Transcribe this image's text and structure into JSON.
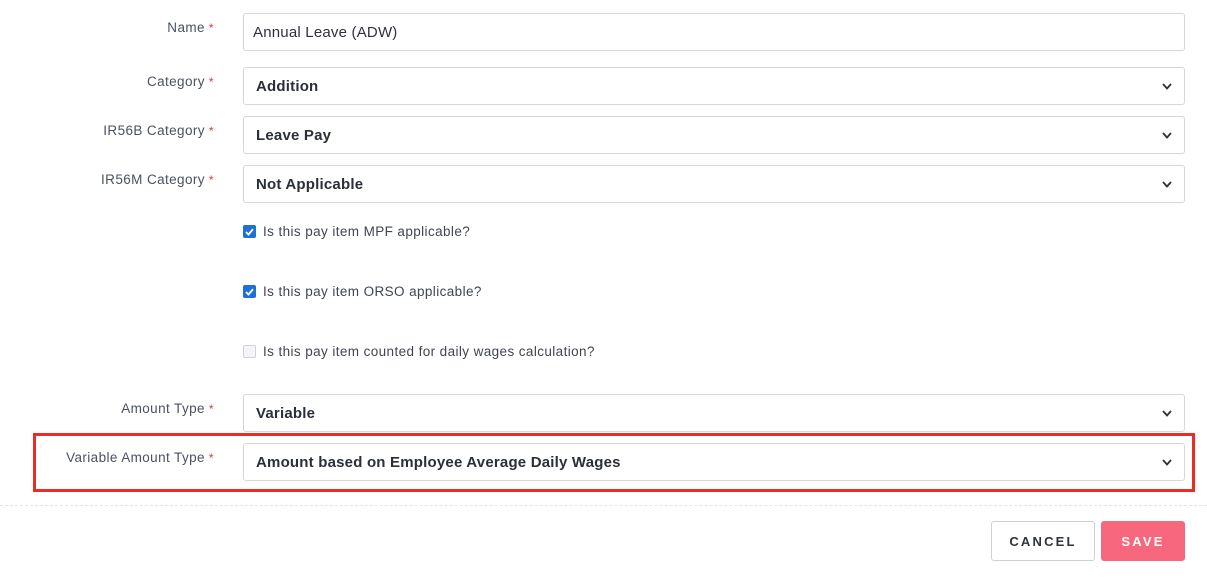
{
  "form": {
    "name": {
      "label": "Name",
      "required_mark": "*",
      "value": "Annual Leave (ADW)"
    },
    "category": {
      "label": "Category",
      "required_mark": "*",
      "value": "Addition"
    },
    "ir56b_category": {
      "label": "IR56B Category",
      "required_mark": "*",
      "value": "Leave Pay"
    },
    "ir56m_category": {
      "label": "IR56M Category",
      "required_mark": "*",
      "value": "Not Applicable"
    },
    "checkboxes": [
      {
        "label": "Is this pay item MPF applicable?",
        "checked": true
      },
      {
        "label": "Is this pay item ORSO applicable?",
        "checked": true
      },
      {
        "label": "Is this pay item counted for daily wages calculation?",
        "checked": false
      }
    ],
    "amount_type": {
      "label": "Amount Type",
      "required_mark": "*",
      "value": "Variable"
    },
    "variable_amount_type": {
      "label": "Variable Amount Type",
      "required_mark": "*",
      "value": "Amount based on Employee Average Daily Wages"
    }
  },
  "actions": {
    "cancel_label": "CANCEL",
    "save_label": "SAVE"
  },
  "colors": {
    "required": "#e0323c",
    "checkbox_checked": "#1f6fd8",
    "save_button": "#f7677d",
    "highlight_box": "#ec2b22"
  },
  "icons": {
    "select_arrow": "chevron-down-icon",
    "checkbox_check": "check-icon"
  }
}
